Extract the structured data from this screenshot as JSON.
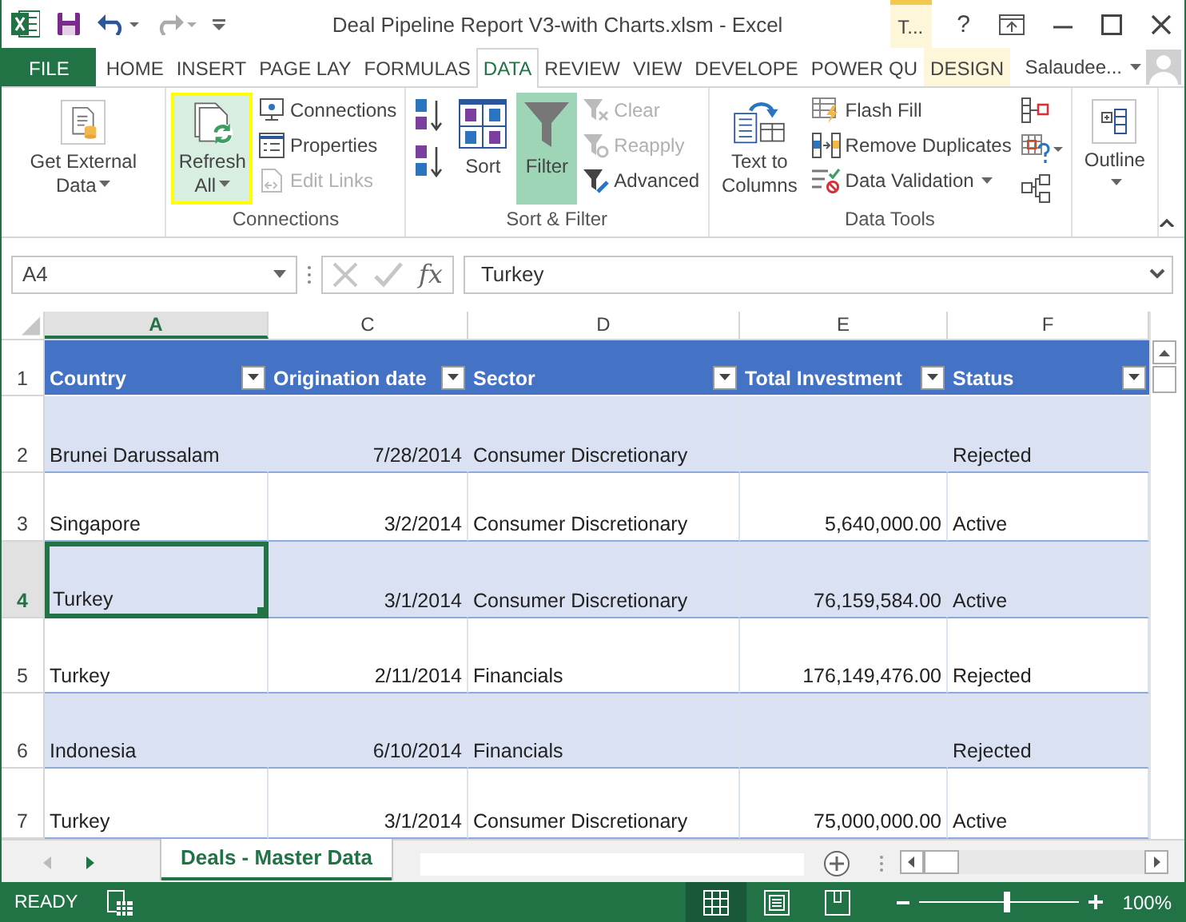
{
  "title_bar": {
    "title": "Deal Pipeline Report V3-with Charts.xlsm - Excel",
    "context_tab": "T...",
    "help": "?"
  },
  "tabs": [
    {
      "label": "FILE",
      "selected": false,
      "kind": "file"
    },
    {
      "label": "HOME",
      "selected": false,
      "kind": "tab"
    },
    {
      "label": "INSERT",
      "selected": false,
      "kind": "tab"
    },
    {
      "label": "PAGE LAY",
      "selected": false,
      "kind": "tab"
    },
    {
      "label": "FORMULAS",
      "selected": false,
      "kind": "tab"
    },
    {
      "label": "DATA",
      "selected": true,
      "kind": "tab"
    },
    {
      "label": "REVIEW",
      "selected": false,
      "kind": "tab"
    },
    {
      "label": "VIEW",
      "selected": false,
      "kind": "tab"
    },
    {
      "label": "DEVELOPE",
      "selected": false,
      "kind": "tab"
    },
    {
      "label": "POWER QU",
      "selected": false,
      "kind": "tab"
    },
    {
      "label": "DESIGN",
      "selected": false,
      "kind": "context"
    }
  ],
  "user": "Salaudee...",
  "ribbon": {
    "groups": [
      {
        "columns": [
          [
            {
              "kind": "large",
              "label": "Get External Data",
              "dropdown": true,
              "disabled": false,
              "on": false,
              "highlighted": false
            }
          ]
        ]
      },
      {
        "label": "Connections",
        "columns": [
          [
            {
              "kind": "large",
              "label": "Refresh All",
              "dropdown": true,
              "disabled": false,
              "on": false,
              "highlighted": true
            }
          ],
          [
            {
              "kind": "small",
              "label": "Connections",
              "dropdown": false,
              "disabled": false,
              "on": false,
              "highlighted": false
            },
            {
              "kind": "small",
              "label": "Properties",
              "dropdown": false,
              "disabled": false,
              "on": false,
              "highlighted": false
            },
            {
              "kind": "small",
              "label": "Edit Links",
              "dropdown": false,
              "disabled": true,
              "on": false,
              "highlighted": false
            }
          ]
        ]
      },
      {
        "label": "Sort & Filter",
        "columns": [
          [
            {
              "kind": "icon",
              "dropdown": false,
              "disabled": false,
              "on": false,
              "highlighted": false
            },
            {
              "kind": "icon",
              "dropdown": false,
              "disabled": false,
              "on": false,
              "highlighted": false
            }
          ],
          [
            {
              "kind": "large",
              "label": "Sort",
              "dropdown": false,
              "disabled": false,
              "on": false,
              "highlighted": false
            }
          ],
          [
            {
              "kind": "large",
              "label": "Filter",
              "dropdown": false,
              "disabled": false,
              "on": true,
              "highlighted": false
            }
          ],
          [
            {
              "kind": "small",
              "label": "Clear",
              "dropdown": false,
              "disabled": true,
              "on": false,
              "highlighted": false
            },
            {
              "kind": "small",
              "label": "Reapply",
              "dropdown": false,
              "disabled": true,
              "on": false,
              "highlighted": false
            },
            {
              "kind": "small",
              "label": "Advanced",
              "dropdown": false,
              "disabled": false,
              "on": false,
              "highlighted": false
            }
          ]
        ]
      },
      {
        "label": "Data Tools",
        "columns": [
          [
            {
              "kind": "large",
              "label": "Text to Columns",
              "dropdown": false,
              "disabled": false,
              "on": false,
              "highlighted": false
            }
          ],
          [
            {
              "kind": "small",
              "label": "Flash Fill",
              "dropdown": false,
              "disabled": false,
              "on": false,
              "highlighted": false
            },
            {
              "kind": "small",
              "label": "Remove Duplicates",
              "dropdown": false,
              "disabled": false,
              "on": false,
              "highlighted": false
            },
            {
              "kind": "small",
              "label": "Data Validation",
              "dropdown": true,
              "disabled": false,
              "on": false,
              "highlighted": false
            }
          ],
          [
            {
              "kind": "icon",
              "dropdown": false,
              "disabled": false,
              "on": false,
              "highlighted": false
            },
            {
              "kind": "icon",
              "dropdown": true,
              "disabled": false,
              "on": false,
              "highlighted": false
            },
            {
              "kind": "icon",
              "dropdown": false,
              "disabled": false,
              "on": false,
              "highlighted": false
            }
          ]
        ]
      },
      {
        "columns": [
          [
            {
              "kind": "large",
              "label": "Outline",
              "dropdown": true,
              "disabled": false,
              "on": false,
              "highlighted": false
            }
          ]
        ]
      }
    ]
  },
  "formula_bar": {
    "name_box": "A4",
    "function_label": "fx",
    "formula": "Turkey"
  },
  "columns": [
    {
      "letter": "A",
      "selected": true,
      "kind": "text"
    },
    {
      "letter": "C",
      "selected": false,
      "kind": "date"
    },
    {
      "letter": "D",
      "selected": false,
      "kind": "text"
    },
    {
      "letter": "E",
      "selected": false,
      "kind": "amount"
    },
    {
      "letter": "F",
      "selected": false,
      "kind": "text"
    }
  ],
  "rows": [
    {
      "number": "1",
      "selected": false,
      "kind": "header",
      "cells": [
        {
          "text": "Country",
          "selected": false
        },
        {
          "text": "Origination date",
          "selected": false
        },
        {
          "text": "Sector",
          "selected": false
        },
        {
          "text": "Total Investment",
          "selected": false
        },
        {
          "text": "Status",
          "selected": false
        }
      ]
    },
    {
      "number": "2",
      "selected": false,
      "kind": "data",
      "cells": [
        {
          "text": "Brunei Darussalam",
          "selected": false
        },
        {
          "text": "7/28/2014",
          "selected": false
        },
        {
          "text": "Consumer Discretionary",
          "selected": false
        },
        {
          "text": "",
          "selected": false
        },
        {
          "text": "Rejected",
          "selected": false
        }
      ]
    },
    {
      "number": "3",
      "selected": false,
      "kind": "data",
      "cells": [
        {
          "text": "Singapore",
          "selected": false
        },
        {
          "text": "3/2/2014",
          "selected": false
        },
        {
          "text": "Consumer Discretionary",
          "selected": false
        },
        {
          "text": "5,640,000.00",
          "selected": false
        },
        {
          "text": "Active",
          "selected": false
        }
      ]
    },
    {
      "number": "4",
      "selected": true,
      "kind": "data",
      "cells": [
        {
          "text": "Turkey",
          "selected": true
        },
        {
          "text": "3/1/2014",
          "selected": false
        },
        {
          "text": "Consumer Discretionary",
          "selected": false
        },
        {
          "text": "76,159,584.00",
          "selected": false
        },
        {
          "text": "Active",
          "selected": false
        }
      ]
    },
    {
      "number": "5",
      "selected": false,
      "kind": "data",
      "cells": [
        {
          "text": "Turkey",
          "selected": false
        },
        {
          "text": "2/11/2014",
          "selected": false
        },
        {
          "text": "Financials",
          "selected": false
        },
        {
          "text": "176,149,476.00",
          "selected": false
        },
        {
          "text": "Rejected",
          "selected": false
        }
      ]
    },
    {
      "number": "6",
      "selected": false,
      "kind": "data",
      "cells": [
        {
          "text": "Indonesia",
          "selected": false
        },
        {
          "text": "6/10/2014",
          "selected": false
        },
        {
          "text": "Financials",
          "selected": false
        },
        {
          "text": "",
          "selected": false
        },
        {
          "text": "Rejected",
          "selected": false
        }
      ]
    },
    {
      "number": "7",
      "selected": false,
      "kind": "data",
      "cells": [
        {
          "text": "Turkey",
          "selected": false
        },
        {
          "text": "3/1/2014",
          "selected": false
        },
        {
          "text": "Consumer Discretionary",
          "selected": false
        },
        {
          "text": "75,000,000.00",
          "selected": false
        },
        {
          "text": "Active",
          "selected": false
        }
      ]
    }
  ],
  "sheets": [
    {
      "label": "Deals - Master Data",
      "selected": true
    }
  ],
  "status_bar": {
    "mode": "READY",
    "views": [
      {
        "selected": true
      },
      {
        "selected": false
      },
      {
        "selected": false
      }
    ],
    "zoom": {
      "level": 0.55,
      "reading": "100%"
    }
  }
}
